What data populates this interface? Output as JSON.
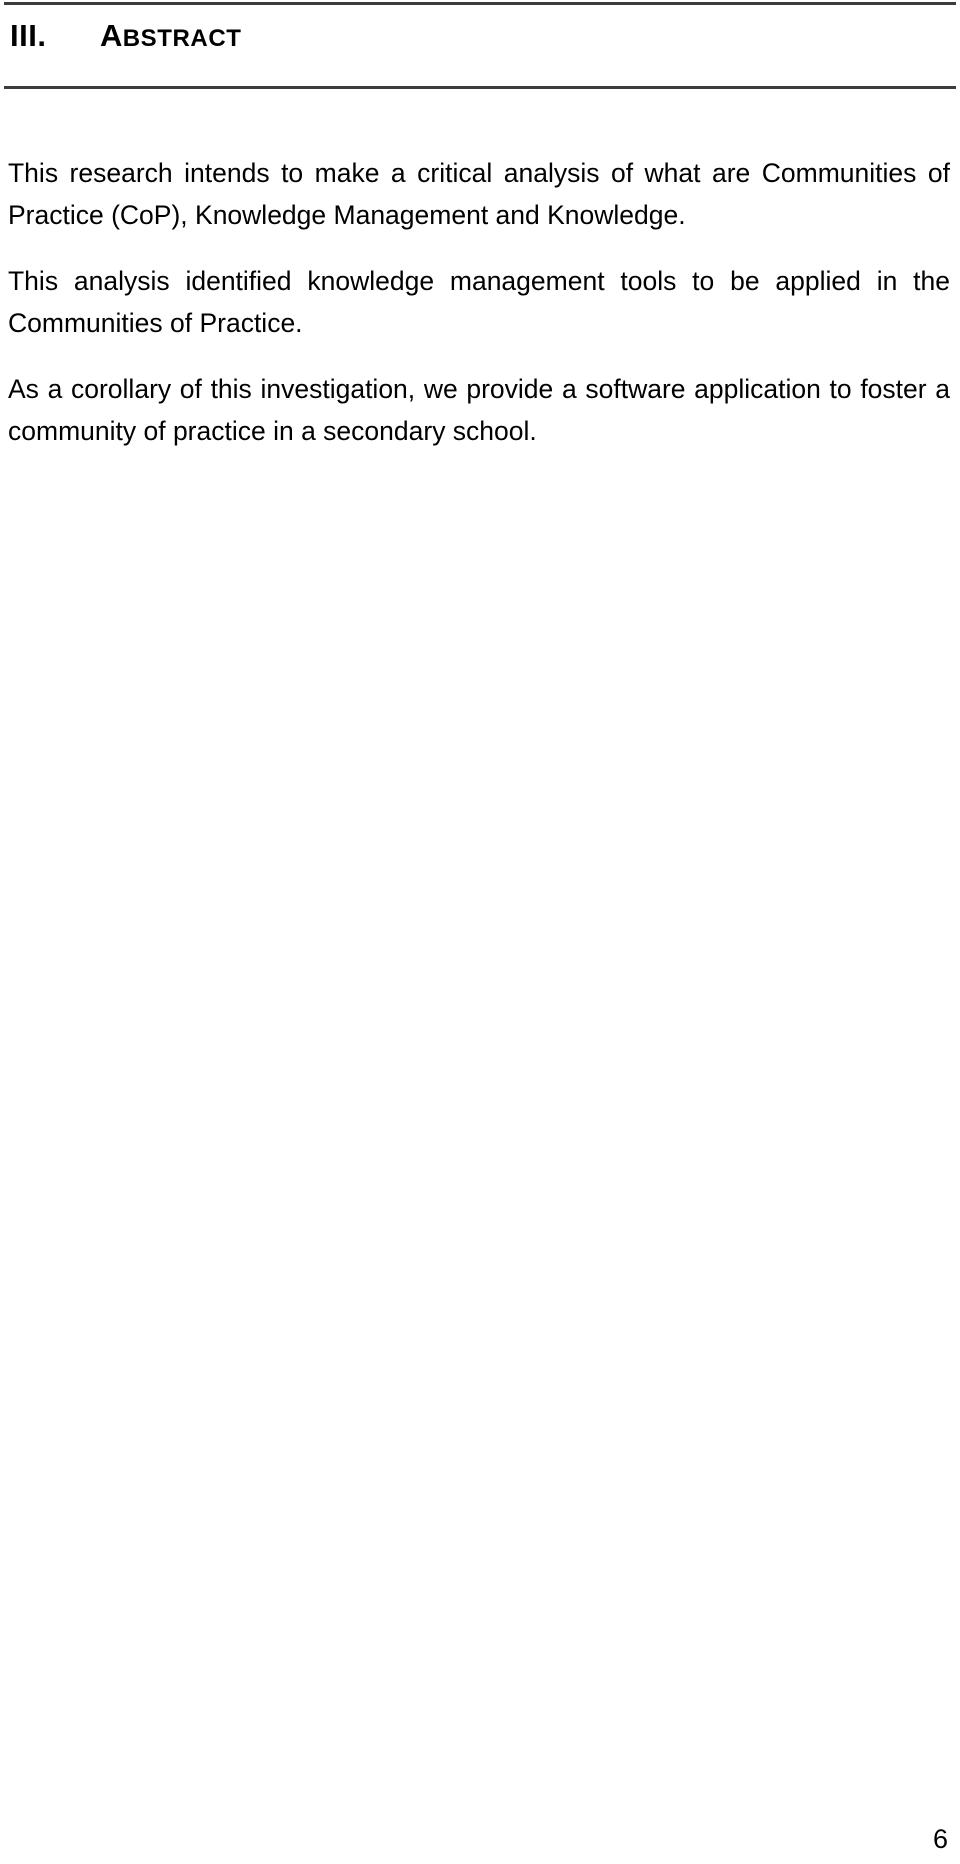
{
  "document": {
    "section": {
      "number": "III.",
      "title_first_letter": "A",
      "title_rest": "bstract",
      "title_full": "ABSTRACT"
    },
    "paragraphs": [
      "This research intends to make a critical analysis of what are Communities of Practice (CoP), Knowledge Management and Knowledge.",
      "This analysis identified knowledge management tools to be applied in the Communities of Practice.",
      "As a corollary of this investigation, we provide a software application to foster a community of practice in a secondary school."
    ],
    "page_number": "6"
  },
  "colors": {
    "text": "#000000",
    "rule": "#3c3c3c",
    "background": "#ffffff"
  }
}
